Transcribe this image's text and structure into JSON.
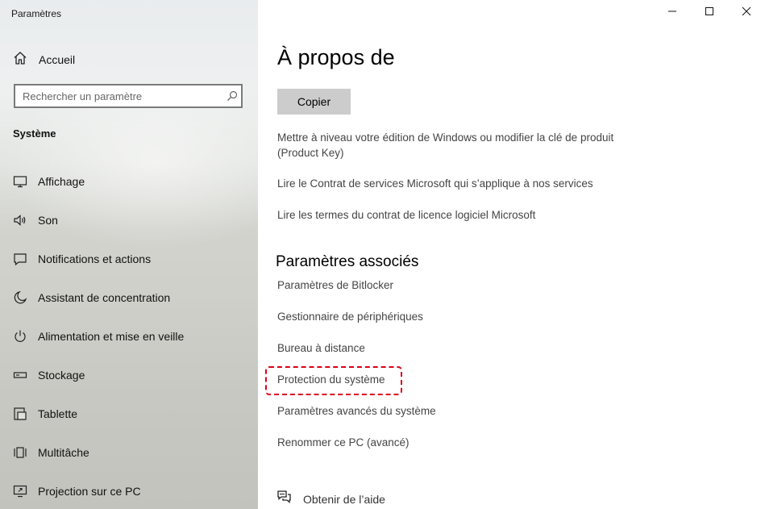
{
  "window": {
    "title": "Paramètres",
    "controls": {
      "minimize": "minimize-icon",
      "maximize": "maximize-icon",
      "close": "close-icon"
    }
  },
  "sidebar": {
    "home": {
      "label": "Accueil",
      "icon": "home-icon"
    },
    "search": {
      "placeholder": "Rechercher un paramètre",
      "value": "",
      "icon": "search-icon"
    },
    "section_title": "Système",
    "items": [
      {
        "label": "Affichage",
        "icon": "display-icon"
      },
      {
        "label": "Son",
        "icon": "speaker-icon"
      },
      {
        "label": "Notifications et actions",
        "icon": "notification-icon"
      },
      {
        "label": "Assistant de concentration",
        "icon": "moon-icon"
      },
      {
        "label": "Alimentation et mise en veille",
        "icon": "power-icon"
      },
      {
        "label": "Stockage",
        "icon": "storage-icon"
      },
      {
        "label": "Tablette",
        "icon": "tablet-icon"
      },
      {
        "label": "Multitâche",
        "icon": "multitask-icon"
      },
      {
        "label": "Projection sur ce PC",
        "icon": "projection-icon"
      }
    ]
  },
  "main": {
    "title": "À propos de",
    "copy_button": "Copier",
    "links": {
      "upgrade": "Mettre à niveau votre édition de Windows ou modifier la clé de produit (Product Key)",
      "services_agreement": "Lire le Contrat de services Microsoft qui s’applique à nos services",
      "license_terms": "Lire les termes du contrat de licence logiciel Microsoft"
    },
    "related": {
      "title": "Paramètres associés",
      "items": [
        "Paramètres de Bitlocker",
        "Gestionnaire de périphériques",
        "Bureau à distance",
        "Protection du système",
        "Paramètres avancés du système",
        "Renommer ce PC (avancé)"
      ],
      "highlighted_item": "Protection du système"
    },
    "help": {
      "label": "Obtenir de l’aide",
      "icon": "help-chat-icon"
    }
  },
  "colors": {
    "highlight_border": "#d9001b",
    "link_text": "#444444",
    "button_bg": "#cccccc"
  }
}
